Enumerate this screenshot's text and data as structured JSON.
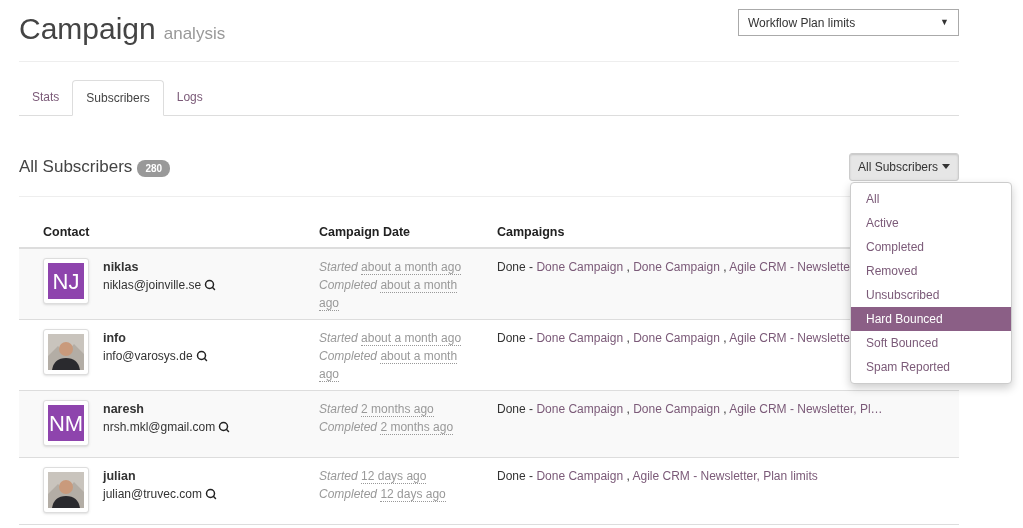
{
  "header": {
    "title": "Campaign",
    "subtitle": "analysis",
    "select_value": "Workflow Plan limits",
    "select_arrow": "▼"
  },
  "tabs": [
    {
      "label": "Stats",
      "selected": false
    },
    {
      "label": "Subscribers",
      "selected": true
    },
    {
      "label": "Logs",
      "selected": false
    }
  ],
  "section": {
    "title": "All Subscribers",
    "count": "280",
    "filter_button": "All Subscribers"
  },
  "filter_menu": [
    {
      "label": "All",
      "selected": false
    },
    {
      "label": "Active",
      "selected": false
    },
    {
      "label": "Completed",
      "selected": false
    },
    {
      "label": "Removed",
      "selected": false
    },
    {
      "label": "Unsubscribed",
      "selected": false
    },
    {
      "label": "Hard Bounced",
      "selected": true
    },
    {
      "label": "Soft Bounced",
      "selected": false
    },
    {
      "label": "Spam Reported",
      "selected": false
    }
  ],
  "table": {
    "columns": [
      "Contact",
      "Campaign Date",
      "Campaigns"
    ],
    "rows": [
      {
        "avatar": {
          "kind": "initials",
          "text": "NJ"
        },
        "name": "niklas",
        "email": "niklas@joinville.se",
        "started_label": "Started",
        "started": "about a month ago",
        "completed_label": "Completed",
        "completed": "about a month ago",
        "campaigns": [
          {
            "kind": "status",
            "text": "Done -"
          },
          {
            "kind": "link",
            "text": "Done Campaign"
          },
          {
            "kind": "sep",
            "text": ","
          },
          {
            "kind": "link",
            "text": "Done Campaign"
          },
          {
            "kind": "sep",
            "text": ","
          },
          {
            "kind": "link",
            "text": "Agile CRM - Newslette"
          }
        ]
      },
      {
        "name": "info",
        "email": "info@varosys.de",
        "started_label": "Started",
        "started": "about a month ago",
        "completed_label": "Completed",
        "completed": "about a month ago",
        "campaigns": [
          {
            "kind": "status",
            "text": "Done -"
          },
          {
            "kind": "link",
            "text": "Done Campaign"
          },
          {
            "kind": "sep",
            "text": ","
          },
          {
            "kind": "link",
            "text": "Done Campaign"
          },
          {
            "kind": "sep",
            "text": ","
          },
          {
            "kind": "link",
            "text": "Agile CRM - Newslette"
          }
        ]
      },
      {
        "avatar": {
          "kind": "initials",
          "text": "NM"
        },
        "name": "naresh",
        "email": "nrsh.mkl@gmail.com",
        "started_label": "Started",
        "started": "2 months ago",
        "completed_label": "Completed",
        "completed": "2 months ago",
        "campaigns": [
          {
            "kind": "status",
            "text": "Done -"
          },
          {
            "kind": "link",
            "text": "Done Campaign"
          },
          {
            "kind": "sep",
            "text": ","
          },
          {
            "kind": "link",
            "text": "Done Campaign"
          },
          {
            "kind": "sep",
            "text": ","
          },
          {
            "kind": "link",
            "text": "Agile CRM - Newsletter, Pl…"
          }
        ]
      },
      {
        "name": "julian",
        "email": "julian@truvec.com",
        "started_label": "Started",
        "started": "12 days ago",
        "completed_label": "Completed",
        "completed": "12 days ago",
        "campaigns": [
          {
            "kind": "status",
            "text": "Done -"
          },
          {
            "kind": "link",
            "text": "Done Campaign"
          },
          {
            "kind": "sep",
            "text": ","
          },
          {
            "kind": "link",
            "text": "Agile CRM - Newsletter, Plan limits"
          }
        ]
      }
    ]
  }
}
